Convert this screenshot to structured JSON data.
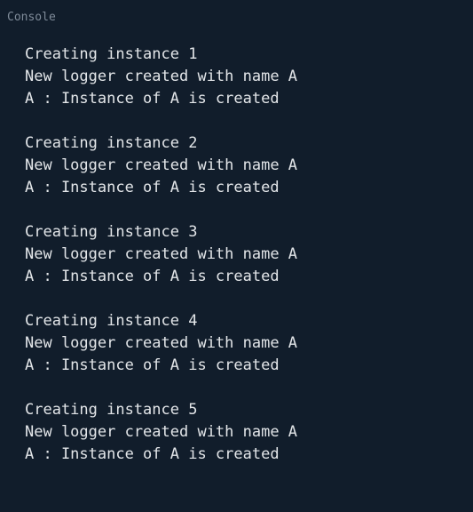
{
  "console": {
    "title": "Console",
    "lines": [
      "Creating instance 1",
      "New logger created with name A",
      "A : Instance of A is created",
      "",
      "Creating instance 2",
      "New logger created with name A",
      "A : Instance of A is created",
      "",
      "Creating instance 3",
      "New logger created with name A",
      "A : Instance of A is created",
      "",
      "Creating instance 4",
      "New logger created with name A",
      "A : Instance of A is created",
      "",
      "Creating instance 5",
      "New logger created with name A",
      "A : Instance of A is created"
    ]
  },
  "colors": {
    "background": "#111d2b",
    "text": "#e3e6e9",
    "title": "#7f8b99"
  }
}
